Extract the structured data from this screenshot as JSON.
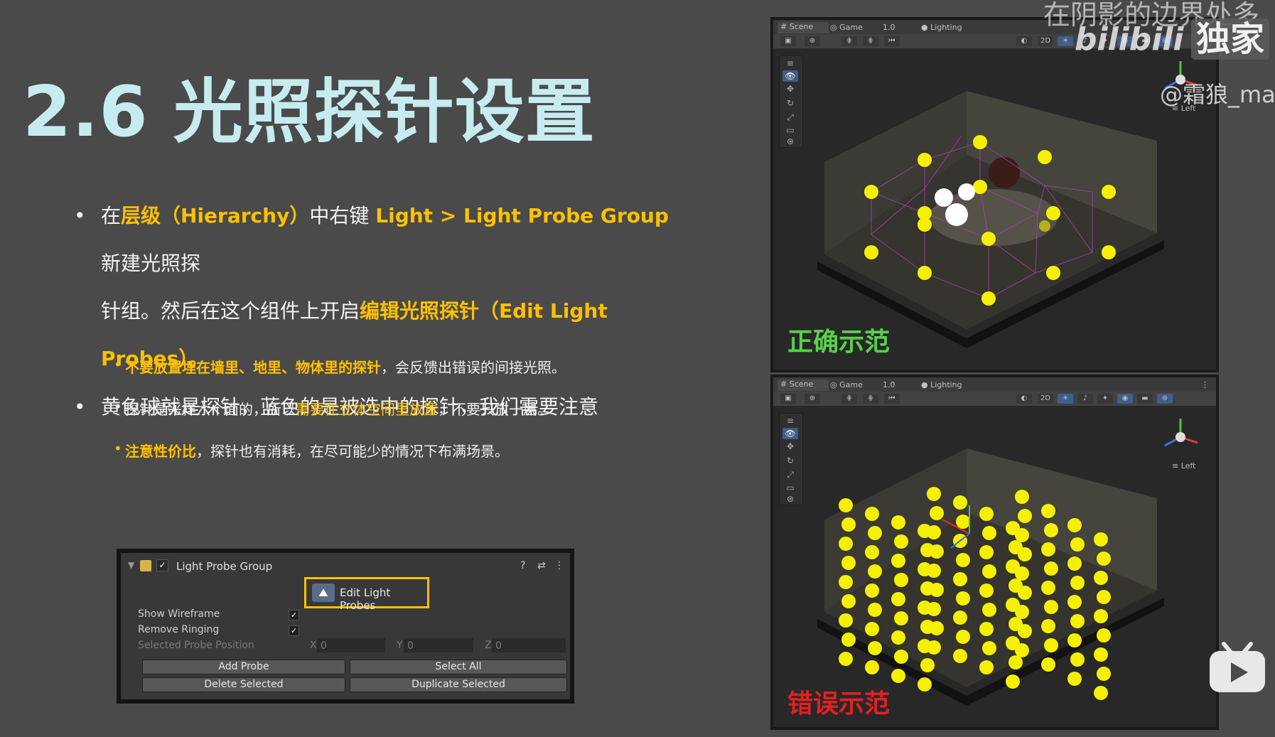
{
  "title": "2.6 光照探针设置",
  "bullet1": {
    "pre": "在",
    "hl1": "层级（Hierarchy）",
    "mid": "中右键 ",
    "hl2": "Light > Light Probe Group",
    "post1": " 新建光照探",
    "line2_pre": "针组。然后在这个组件上开启",
    "hl3": "编辑光照探针（Edit Light Probes）",
    "end": "。"
  },
  "bullet2": {
    "text": "黄色球就是探针，蓝色的是被选中的探针，我们需要注意"
  },
  "sub1": {
    "hl": "不要放置埋在墙里、地里、物体里的探针",
    "post": "，会反馈出错误的间接光照。"
  },
  "sub2": {
    "pre": "探针是采样六个面的，所以",
    "hl": "需要在立体空间里放置",
    "post": "，不要只放一层。"
  },
  "sub3": {
    "hl": "注意性价比",
    "post": "，探针也有消耗，在尽可能少的情况下布满场景。"
  },
  "inspector": {
    "component_name": "Light Probe Group",
    "edit_label": "Edit Light Probes",
    "show_wireframe_label": "Show Wireframe",
    "remove_ringing_label": "Remove Ringing",
    "selected_pos_label": "Selected Probe Position",
    "x_label": "X",
    "y_label": "Y",
    "z_label": "Z",
    "x_value": "0",
    "y_value": "0",
    "z_value": "0",
    "add_probe": "Add Probe",
    "select_all": "Select All",
    "delete_selected": "Delete Selected",
    "duplicate_selected": "Duplicate Selected",
    "checkmark": "✓"
  },
  "scene_tabs": {
    "scene": "Scene",
    "game": "Game",
    "scale": "1.0",
    "lighting": "Lighting",
    "mode_2d": "2D",
    "view_label": "Left"
  },
  "captions": {
    "correct": "正确示范",
    "wrong": "错误示范"
  },
  "watermark": {
    "top": "在阴影的边界处多",
    "logo": "bilibili",
    "exclusive": "独家",
    "user": "@霜狼_may"
  },
  "colors": {
    "accent": "#ffc000",
    "title": "#c6ecf0",
    "correct": "#58d04c",
    "wrong": "#e22020",
    "probe": "#f5f000"
  },
  "icons": [
    "fold-arrow-icon",
    "light-probe-component-icon",
    "edit-probes-icon",
    "help-icon",
    "preset-icon",
    "more-menu-icon",
    "bilibili-tv-icon"
  ]
}
